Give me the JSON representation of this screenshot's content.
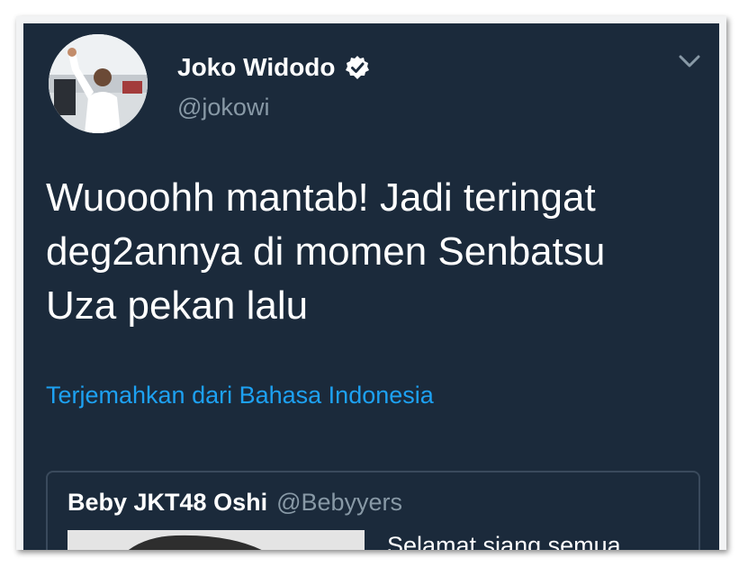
{
  "author": {
    "name": "Joko Widodo",
    "handle": "@jokowi"
  },
  "tweet": {
    "lines": [
      "Wuooohh mantab! Jadi teringat",
      "deg2annya di momen Senbatsu",
      "Uza pekan lalu"
    ],
    "translate_link": "Terjemahkan dari Bahasa Indonesia"
  },
  "quoted_tweet": {
    "name": "Beby JKT48 Oshi",
    "handle": "@Bebyyers",
    "text": "Selamat siang semua"
  },
  "icons": {
    "verified": "verified-badge-icon",
    "more": "chevron-down-icon"
  },
  "colors": {
    "background": "#1b2a3b",
    "link": "#1da1f2",
    "secondary_text": "#8899a6"
  }
}
